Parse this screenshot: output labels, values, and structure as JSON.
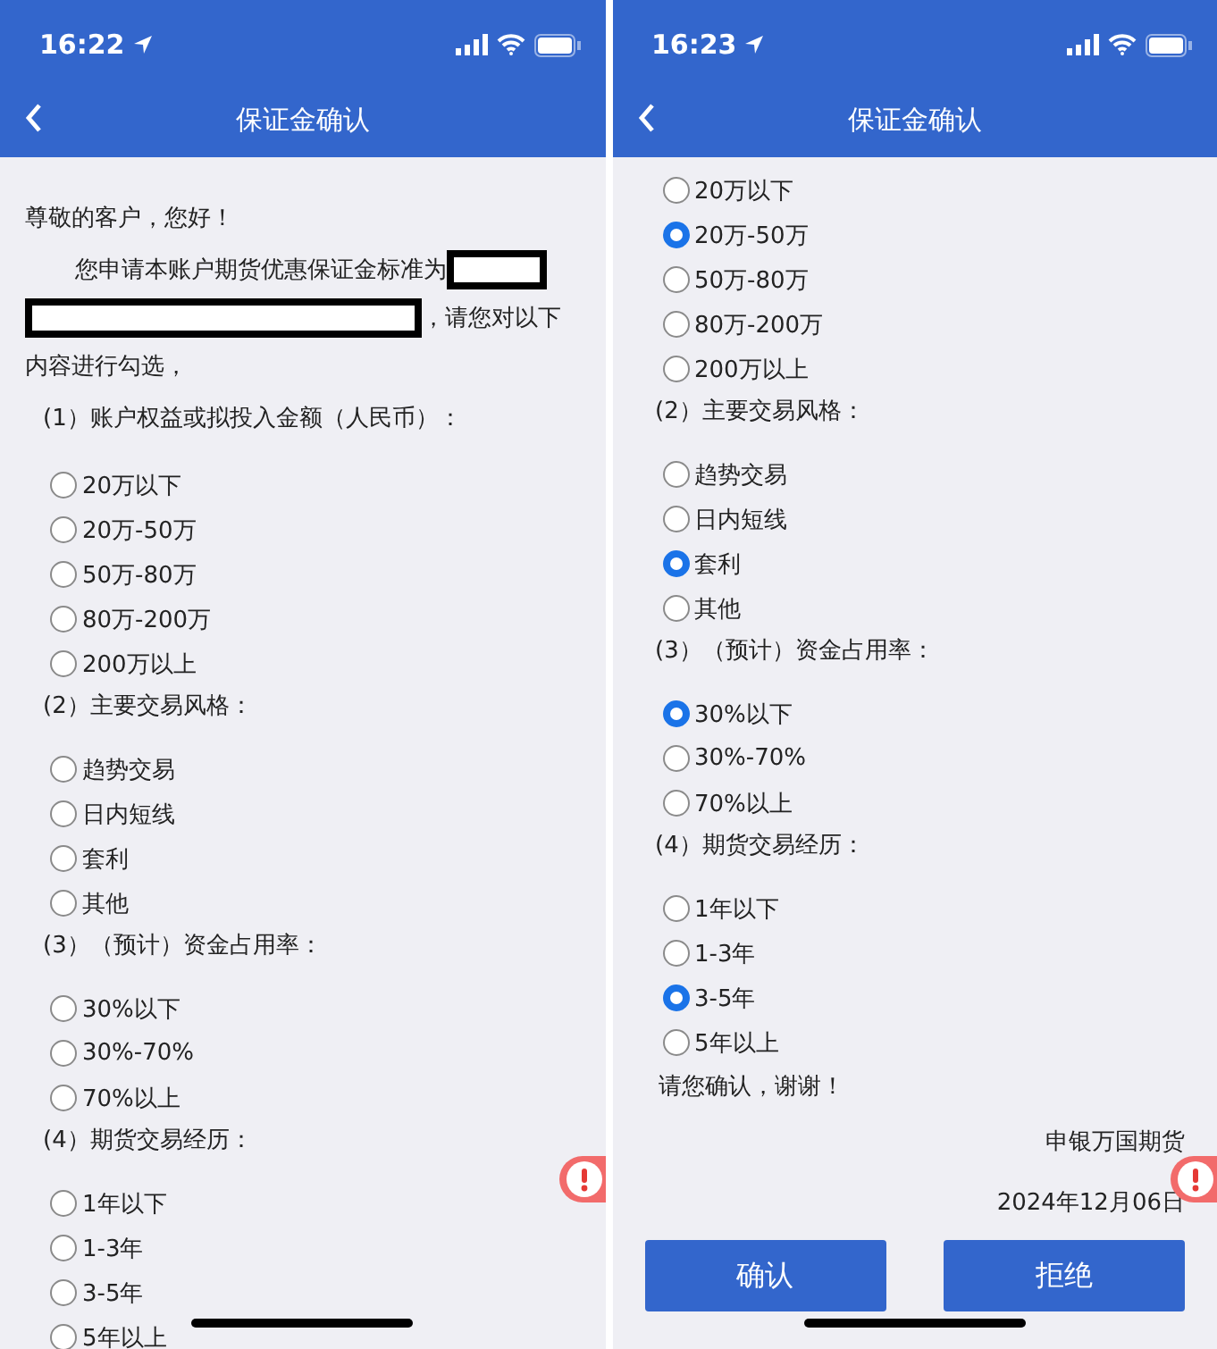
{
  "screens": [
    {
      "time": "16:22",
      "title": "保证金确认",
      "greeting": "尊敬的客户，您好！",
      "intro_before": "您申请本账户期货优惠保证金标准为",
      "intro_after": "，请您对以下内容进行勾选，",
      "questions": [
        {
          "heading": "(1）账户权益或拟投入金额（人民币）：",
          "options": [
            {
              "label": "20万以下",
              "selected": false
            },
            {
              "label": "20万-50万",
              "selected": false
            },
            {
              "label": "50万-80万",
              "selected": false
            },
            {
              "label": "80万-200万",
              "selected": false
            },
            {
              "label": "200万以上",
              "selected": false
            }
          ]
        },
        {
          "heading": "(2）主要交易风格：",
          "options": [
            {
              "label": "趋势交易",
              "selected": false
            },
            {
              "label": "日内短线",
              "selected": false
            },
            {
              "label": "套利",
              "selected": false
            },
            {
              "label": "其他",
              "selected": false
            }
          ]
        },
        {
          "heading": "(3）（预计）资金占用率：",
          "options": [
            {
              "label": "30%以下",
              "selected": false
            },
            {
              "label": "30%-70%",
              "selected": false
            },
            {
              "label": "70%以上",
              "selected": false
            }
          ]
        },
        {
          "heading": "(4）期货交易经历：",
          "options": [
            {
              "label": "1年以下",
              "selected": false
            },
            {
              "label": "1-3年",
              "selected": false
            },
            {
              "label": "3-5年",
              "selected": false
            },
            {
              "label": "5年以上",
              "selected": false
            }
          ]
        }
      ]
    },
    {
      "time": "16:23",
      "title": "保证金确认",
      "questions": [
        {
          "options": [
            {
              "label": "20万以下",
              "selected": false
            },
            {
              "label": "20万-50万",
              "selected": true
            },
            {
              "label": "50万-80万",
              "selected": false
            },
            {
              "label": "80万-200万",
              "selected": false
            },
            {
              "label": "200万以上",
              "selected": false
            }
          ]
        },
        {
          "heading": "(2）主要交易风格：",
          "options": [
            {
              "label": "趋势交易",
              "selected": false
            },
            {
              "label": "日内短线",
              "selected": false
            },
            {
              "label": "套利",
              "selected": true
            },
            {
              "label": "其他",
              "selected": false
            }
          ]
        },
        {
          "heading": "(3）（预计）资金占用率：",
          "options": [
            {
              "label": "30%以下",
              "selected": true
            },
            {
              "label": "30%-70%",
              "selected": false
            },
            {
              "label": "70%以上",
              "selected": false
            }
          ]
        },
        {
          "heading": "(4）期货交易经历：",
          "options": [
            {
              "label": "1年以下",
              "selected": false
            },
            {
              "label": "1-3年",
              "selected": false
            },
            {
              "label": "3-5年",
              "selected": true
            },
            {
              "label": "5年以上",
              "selected": false
            }
          ]
        }
      ],
      "closing": "请您确认，谢谢！",
      "signature": "申银万国期货",
      "date": "2024年12月06日",
      "buttons": [
        "确认",
        "拒绝"
      ]
    }
  ]
}
